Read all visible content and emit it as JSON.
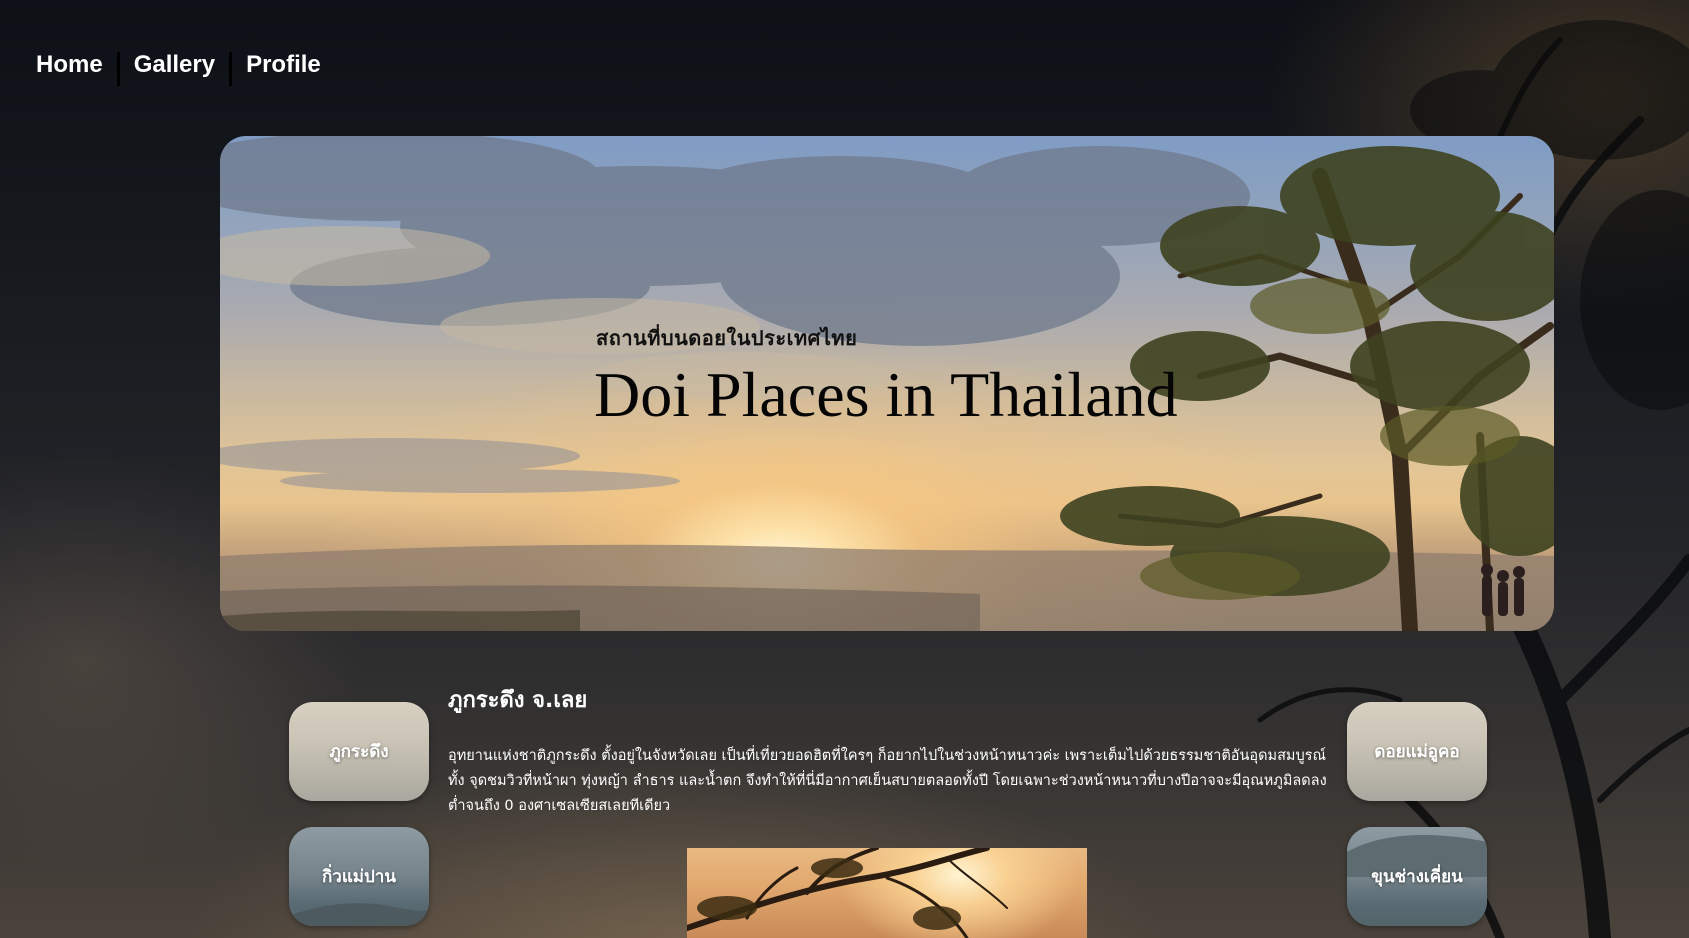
{
  "nav": {
    "items": [
      {
        "label": "Home"
      },
      {
        "label": "Gallery"
      },
      {
        "label": "Profile"
      }
    ]
  },
  "hero": {
    "subtitle": "สถานที่บนดอยในประเทศไทย",
    "title": "Doi Places in Thailand"
  },
  "places_left": [
    {
      "label": "ภูกระดึง"
    },
    {
      "label": "กิ่วแม่ปาน"
    }
  ],
  "places_right": [
    {
      "label": "ดอยแม่อูคอ"
    },
    {
      "label": "ขุนช่างเคี่ยน"
    }
  ],
  "content": {
    "title": "ภูกระดึง จ.เลย",
    "description": "อุทยานแห่งชาติภูกระดึง ตั้งอยู่ในจังหวัดเลย เป็นที่เที่ยวยอดฮิตที่ใครๆ ก็อยากไปในช่วงหน้าหนาวค่ะ เพราะเต็มไปด้วยธรรมชาติอันอุดมสมบูรณ์ ทั้ง จุดชมวิวที่หน้าผา ทุ่งหญ้า ลำธาร และน้ำตก จึงทำให้ที่นี่มีอากาศเย็นสบายตลอดทั้งปี โดยเฉพาะช่วงหน้าหนาวที่บางปีอาจจะมีอุณหภูมิลดลงต่ำจนถึง 0 องศาเซลเซียสเลยทีเดียว"
  },
  "colors": {
    "nav_text": "#ffffff",
    "nav_separator": "#000000",
    "hero_title": "#050505",
    "body_text": "#ffffff"
  }
}
